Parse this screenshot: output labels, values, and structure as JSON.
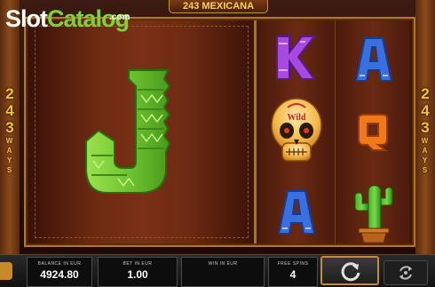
{
  "branding": {
    "site_slot": "Slot",
    "site_catalog": "Catalog",
    "site_com": ".com"
  },
  "game": {
    "title": "243 MEXICANA"
  },
  "ways": {
    "number_digits": [
      "2",
      "4",
      "3"
    ],
    "label_letters": [
      "W",
      "A",
      "Y",
      "S"
    ]
  },
  "reels": {
    "big_symbol": "J",
    "reel2": [
      "K",
      "skull",
      "A"
    ],
    "reel3": [
      "A",
      "Q",
      "cactus"
    ]
  },
  "skull_text": "Wild",
  "hud": {
    "balance_label": "BALANCE IN EUR",
    "balance_value": "4924.80",
    "bet_label": "BET IN EUR",
    "bet_value": "1.00",
    "win_label": "WIN IN EUR",
    "win_value": "",
    "free_spins_label": "FREE SPINS",
    "free_spins_value": "4"
  },
  "colors": {
    "accent": "#c98a2a",
    "brand_green": "#7fd13b",
    "ways_gold": "#f6c13a",
    "k_purple": "#a64ae0",
    "a_blue": "#3a6fe0",
    "q_orange": "#f07a1a",
    "j_green": "#7ccf3a"
  },
  "icons": {
    "spin": "spin-arrow-icon",
    "autoplay": "autoplay-icon",
    "menu": "menu-icon"
  }
}
